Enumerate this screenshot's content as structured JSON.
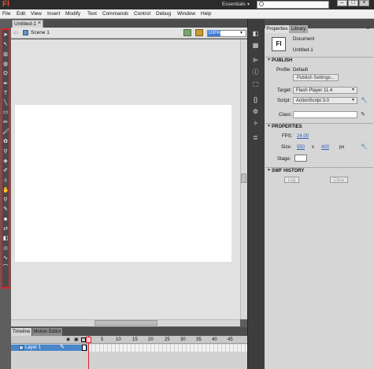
{
  "app": {
    "logo": "Fl",
    "workspace": "Essentials",
    "search_placeholder": ""
  },
  "window_buttons": {
    "minimize": "–",
    "maximize": "□",
    "close": "×"
  },
  "menubar": [
    "File",
    "Edit",
    "View",
    "Insert",
    "Modify",
    "Text",
    "Commands",
    "Control",
    "Debug",
    "Window",
    "Help"
  ],
  "document": {
    "tab_label": "Untitled-1",
    "scene_label": "Scene 1",
    "zoom": "100%"
  },
  "tools": [
    {
      "name": "selection-tool",
      "glyph": "➤"
    },
    {
      "name": "subselection-tool",
      "glyph": "↖"
    },
    {
      "name": "free-transform-tool",
      "glyph": "⊞"
    },
    {
      "name": "3d-rotation-tool",
      "glyph": "◍"
    },
    {
      "name": "lasso-tool",
      "glyph": "ʘ"
    },
    {
      "name": "pen-tool",
      "glyph": "✒"
    },
    {
      "name": "text-tool",
      "glyph": "T"
    },
    {
      "name": "line-tool",
      "glyph": "╲"
    },
    {
      "name": "rectangle-tool",
      "glyph": "▭"
    },
    {
      "name": "pencil-tool",
      "glyph": "✏"
    },
    {
      "name": "brush-tool",
      "glyph": "🖌"
    },
    {
      "name": "deco-tool",
      "glyph": "✿"
    },
    {
      "name": "bone-tool",
      "glyph": "⚲"
    },
    {
      "name": "paint-bucket-tool",
      "glyph": "◈"
    },
    {
      "name": "eyedropper-tool",
      "glyph": "✐"
    },
    {
      "name": "eraser-tool",
      "glyph": "◊"
    },
    {
      "name": "hand-tool",
      "glyph": "✋"
    },
    {
      "name": "zoom-tool",
      "glyph": "⚲"
    },
    {
      "name": "stroke-color-tool",
      "glyph": "✎"
    },
    {
      "name": "fill-color-tool",
      "glyph": "■"
    },
    {
      "name": "swap-colors-tool",
      "glyph": "⇄"
    },
    {
      "name": "black-white-tool",
      "glyph": "◧"
    },
    {
      "name": "snap-tool",
      "glyph": "⊙"
    },
    {
      "name": "smooth-tool",
      "glyph": "∿"
    },
    {
      "name": "straighten-tool",
      "glyph": "⌒"
    }
  ],
  "timeline": {
    "tabs": [
      "Timeline",
      "Motion Editor"
    ],
    "layer_name": "Layer 1",
    "frame_numbers": [
      "1",
      "5",
      "10",
      "15",
      "20",
      "25",
      "30",
      "35",
      "40",
      "45"
    ]
  },
  "properties": {
    "tabs": [
      "Properties",
      "Library"
    ],
    "doc_type": "Document",
    "doc_name": "Untitled-1",
    "fl_icon": "Fl",
    "publish": {
      "header": "PUBLISH",
      "profile_label": "Profile:",
      "profile_value": "Default",
      "publish_settings_button": "Publish Settings...",
      "target_label": "Target:",
      "target_value": "Flash Player 11.4",
      "script_label": "Script:",
      "script_value": "ActionScript 3.0",
      "class_label": "Class:",
      "class_value": ""
    },
    "props": {
      "header": "PROPERTIES",
      "fps_label": "FPS:",
      "fps_value": "24.00",
      "size_label": "Size:",
      "width_value": "550",
      "size_x": "x",
      "height_value": "400",
      "size_unit": "px",
      "stage_label": "Stage:"
    },
    "swf_history": {
      "header": "SWF HISTORY",
      "log_button": "Log",
      "clear_button": "Clear"
    }
  },
  "colors": {
    "highlight_red": "#e0202a",
    "stage_white": "#ffffff",
    "layer_blue": "#4a86c8"
  }
}
